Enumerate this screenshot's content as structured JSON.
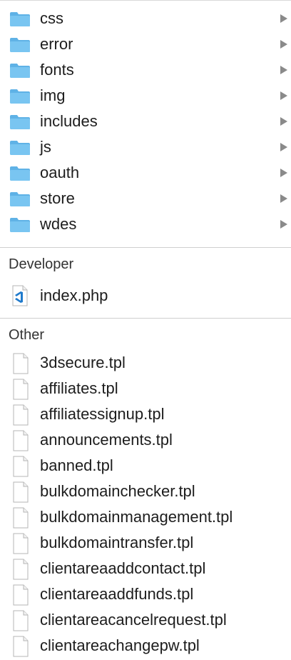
{
  "folders": [
    {
      "name": "css"
    },
    {
      "name": "error"
    },
    {
      "name": "fonts"
    },
    {
      "name": "img"
    },
    {
      "name": "includes"
    },
    {
      "name": "js"
    },
    {
      "name": "oauth"
    },
    {
      "name": "store"
    },
    {
      "name": "wdes"
    }
  ],
  "sections": {
    "developer": {
      "title": "Developer",
      "files": [
        {
          "name": "index.php"
        }
      ]
    },
    "other": {
      "title": "Other",
      "files": [
        {
          "name": "3dsecure.tpl"
        },
        {
          "name": "affiliates.tpl"
        },
        {
          "name": "affiliatessignup.tpl"
        },
        {
          "name": "announcements.tpl"
        },
        {
          "name": "banned.tpl"
        },
        {
          "name": "bulkdomainchecker.tpl"
        },
        {
          "name": "bulkdomainmanagement.tpl"
        },
        {
          "name": "bulkdomaintransfer.tpl"
        },
        {
          "name": "clientareaaddcontact.tpl"
        },
        {
          "name": "clientareaaddfunds.tpl"
        },
        {
          "name": "clientareacancelrequest.tpl"
        },
        {
          "name": "clientareachangepw.tpl"
        }
      ]
    }
  },
  "colors": {
    "folder_body": "#79c5f1",
    "folder_tab": "#5fb2e6",
    "chevron": "#8a8a8a",
    "vscode_blue": "#1f7acc"
  },
  "icons": {
    "folder": "folder-icon",
    "php": "vscode-file-icon",
    "document": "document-icon",
    "chevron": "chevron-right-icon"
  }
}
